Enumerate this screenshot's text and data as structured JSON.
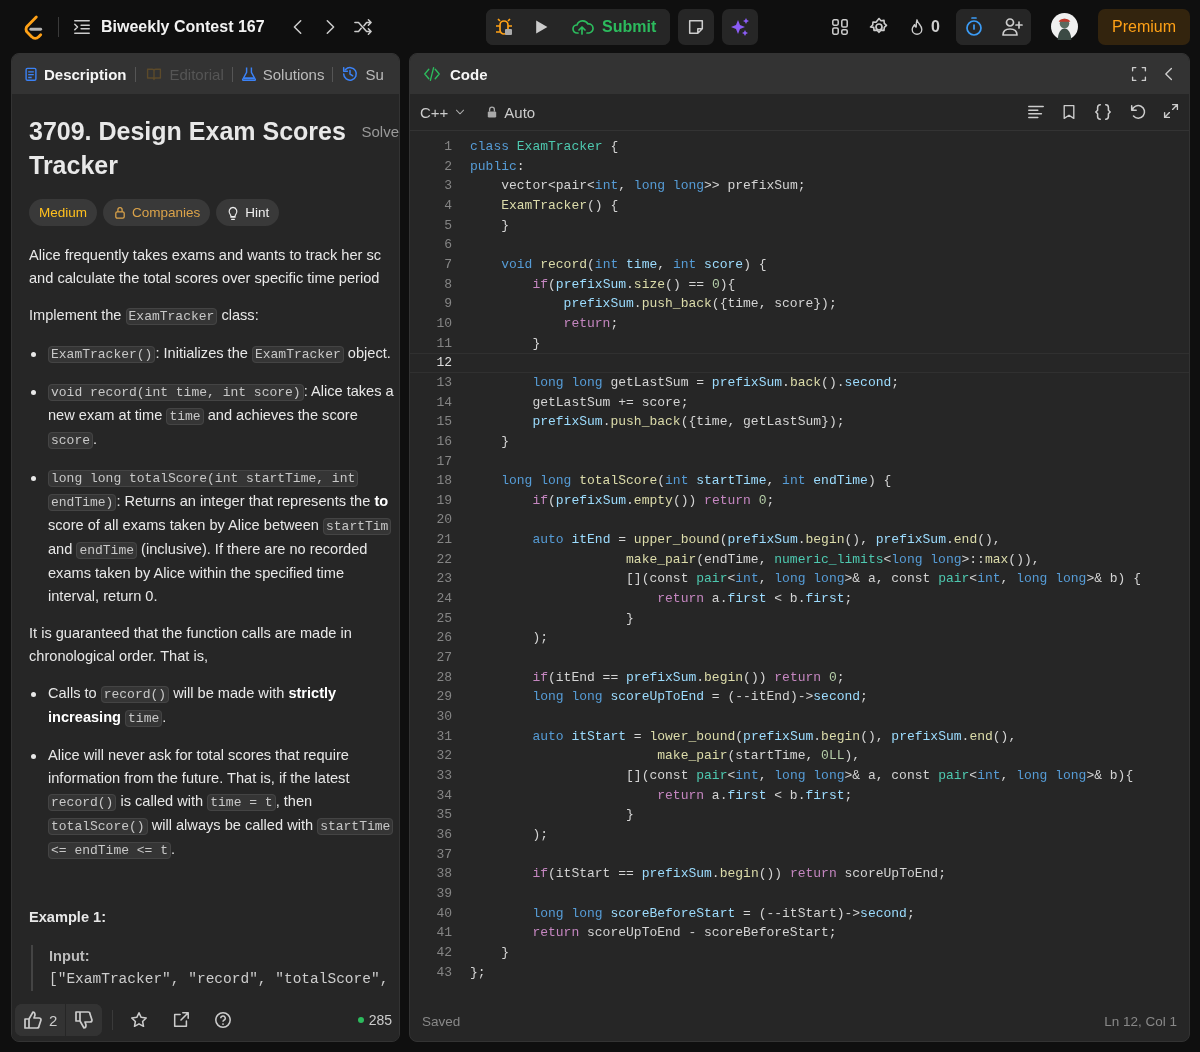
{
  "topbar": {
    "list_title": "Biweekly Contest 167",
    "submit": "Submit",
    "streak": "0",
    "premium": "Premium"
  },
  "description_panel": {
    "tabs": [
      {
        "kind": "doc",
        "label": "Description",
        "selected": true,
        "disabled": false
      },
      {
        "kind": "book",
        "label": "Editorial",
        "selected": false,
        "disabled": true
      },
      {
        "kind": "flask",
        "label": "Solutions",
        "selected": false,
        "disabled": false
      },
      {
        "kind": "history",
        "label": "Su",
        "selected": false,
        "disabled": false
      }
    ],
    "title": "3709. Design Exam Scores Tracker",
    "solved": "Solve",
    "tags": [
      {
        "kind": "difficulty",
        "label": "Medium"
      },
      {
        "kind": "locked",
        "label": "Companies"
      },
      {
        "kind": "hint",
        "label": "Hint"
      }
    ],
    "blocks": [
      {
        "kind": "para",
        "lines": [
          [
            {
              "kind": "text",
              "text": "Alice frequently takes exams and wants to track her sc"
            }
          ],
          [
            {
              "kind": "text",
              "text": "and calculate the total scores over specific time period"
            }
          ]
        ]
      },
      {
        "kind": "para",
        "lines": [
          [
            {
              "kind": "text",
              "text": "Implement the "
            },
            {
              "kind": "code",
              "text": "ExamTracker"
            },
            {
              "kind": "text",
              "text": " class:"
            }
          ]
        ]
      },
      {
        "kind": "bullet",
        "lines": [
          [
            {
              "kind": "code",
              "text": "ExamTracker()"
            },
            {
              "kind": "text",
              "text": ": Initializes the "
            },
            {
              "kind": "code",
              "text": "ExamTracker"
            },
            {
              "kind": "text",
              "text": " object."
            }
          ]
        ]
      },
      {
        "kind": "bullet",
        "lines": [
          [
            {
              "kind": "code",
              "text": "void record(int time, int score)"
            },
            {
              "kind": "text",
              "text": ": Alice takes a"
            }
          ],
          [
            {
              "kind": "text",
              "text": "new exam at time "
            },
            {
              "kind": "code",
              "text": "time"
            },
            {
              "kind": "text",
              "text": " and achieves the score"
            }
          ],
          [
            {
              "kind": "code",
              "text": "score"
            },
            {
              "kind": "text",
              "text": "."
            }
          ]
        ]
      },
      {
        "kind": "bullet",
        "lines": [
          [
            {
              "kind": "code",
              "text": "long long totalScore(int startTime, int"
            }
          ],
          [
            {
              "kind": "code",
              "text": "endTime)"
            },
            {
              "kind": "text",
              "text": ": Returns an integer that represents the "
            },
            {
              "kind": "bold",
              "text": "to"
            }
          ],
          [
            {
              "kind": "text",
              "text": "score of all exams taken by Alice between "
            },
            {
              "kind": "code",
              "text": "startTim"
            }
          ],
          [
            {
              "kind": "text",
              "text": "and "
            },
            {
              "kind": "code",
              "text": "endTime"
            },
            {
              "kind": "text",
              "text": " (inclusive). If there are no recorded"
            }
          ],
          [
            {
              "kind": "text",
              "text": "exams taken by Alice within the specified time"
            }
          ],
          [
            {
              "kind": "text",
              "text": "interval, return 0."
            }
          ]
        ]
      },
      {
        "kind": "para",
        "lines": [
          [
            {
              "kind": "text",
              "text": "It is guaranteed that the function calls are made in"
            }
          ],
          [
            {
              "kind": "text",
              "text": "chronological order. That is,"
            }
          ]
        ]
      },
      {
        "kind": "bullet",
        "lines": [
          [
            {
              "kind": "text",
              "text": "Calls to "
            },
            {
              "kind": "code",
              "text": "record()"
            },
            {
              "kind": "text",
              "text": " will be made with "
            },
            {
              "kind": "bold",
              "text": "strictly"
            }
          ],
          [
            {
              "kind": "bold",
              "text": "increasing "
            },
            {
              "kind": "code",
              "text": "time"
            },
            {
              "kind": "text",
              "text": "."
            }
          ]
        ]
      },
      {
        "kind": "bullet",
        "lines": [
          [
            {
              "kind": "text",
              "text": "Alice will never ask for total scores that require"
            }
          ],
          [
            {
              "kind": "text",
              "text": "information from the future. That is, if the latest"
            }
          ],
          [
            {
              "kind": "code",
              "text": "record()"
            },
            {
              "kind": "text",
              "text": " is called with "
            },
            {
              "kind": "code",
              "text": "time = t"
            },
            {
              "kind": "text",
              "text": ", then"
            }
          ],
          [
            {
              "kind": "code",
              "text": "totalScore()"
            },
            {
              "kind": "text",
              "text": " will always be called with "
            },
            {
              "kind": "code",
              "text": "startTime"
            }
          ],
          [
            {
              "kind": "code",
              "text": "<= endTime <= t"
            },
            {
              "kind": "text",
              "text": "."
            }
          ]
        ]
      },
      {
        "kind": "heading",
        "text": "Example 1:"
      },
      {
        "kind": "example",
        "label": "Input:",
        "code": "[\"ExamTracker\", \"record\", \"totalScore\","
      }
    ],
    "footer": {
      "likes": "2",
      "online": "285"
    }
  },
  "code_panel": {
    "title": "Code",
    "language": "C++",
    "mode": "Auto",
    "status": "Saved",
    "cursor": "Ln 12, Col 1",
    "lines": [
      {
        "n": "1",
        "active": false,
        "t": [
          {
            "kind": "keyword",
            "text": "class "
          },
          {
            "kind": "type",
            "text": "ExamTracker"
          },
          {
            "kind": "plain",
            "text": " {"
          }
        ]
      },
      {
        "n": "2",
        "active": false,
        "t": [
          {
            "kind": "keyword",
            "text": "public"
          },
          {
            "kind": "plain",
            "text": ":"
          }
        ]
      },
      {
        "n": "3",
        "active": false,
        "t": [
          {
            "kind": "plain",
            "text": "    vector<pair<"
          },
          {
            "kind": "keyword",
            "text": "int"
          },
          {
            "kind": "plain",
            "text": ", "
          },
          {
            "kind": "keyword",
            "text": "long long"
          },
          {
            "kind": "plain",
            "text": ">> prefixSum;"
          }
        ]
      },
      {
        "n": "4",
        "active": false,
        "t": [
          {
            "kind": "function",
            "text": "    ExamTracker"
          },
          {
            "kind": "plain",
            "text": "() {"
          }
        ]
      },
      {
        "n": "5",
        "active": false,
        "t": [
          {
            "kind": "plain",
            "text": "    }"
          }
        ]
      },
      {
        "n": "6",
        "active": false
      },
      {
        "n": "7",
        "active": false,
        "t": [
          {
            "kind": "keyword",
            "text": "    void "
          },
          {
            "kind": "function",
            "text": "record"
          },
          {
            "kind": "plain",
            "text": "("
          },
          {
            "kind": "keyword",
            "text": "int "
          },
          {
            "kind": "variable",
            "text": "time"
          },
          {
            "kind": "plain",
            "text": ", "
          },
          {
            "kind": "keyword",
            "text": "int "
          },
          {
            "kind": "variable",
            "text": "score"
          },
          {
            "kind": "plain",
            "text": ") {"
          }
        ]
      },
      {
        "n": "8",
        "active": false,
        "t": [
          {
            "kind": "control",
            "text": "        if"
          },
          {
            "kind": "plain",
            "text": "("
          },
          {
            "kind": "variable",
            "text": "prefixSum"
          },
          {
            "kind": "plain",
            "text": "."
          },
          {
            "kind": "function",
            "text": "size"
          },
          {
            "kind": "plain",
            "text": "() == "
          },
          {
            "kind": "number",
            "text": "0"
          },
          {
            "kind": "plain",
            "text": "){"
          }
        ]
      },
      {
        "n": "9",
        "active": false,
        "t": [
          {
            "kind": "variable",
            "text": "            prefixSum"
          },
          {
            "kind": "plain",
            "text": "."
          },
          {
            "kind": "function",
            "text": "push_back"
          },
          {
            "kind": "plain",
            "text": "({time, score});"
          }
        ]
      },
      {
        "n": "10",
        "active": false,
        "t": [
          {
            "kind": "control",
            "text": "            return"
          },
          {
            "kind": "plain",
            "text": ";"
          }
        ]
      },
      {
        "n": "11",
        "active": false,
        "t": [
          {
            "kind": "plain",
            "text": "        }"
          }
        ]
      },
      {
        "n": "12",
        "active": true
      },
      {
        "n": "13",
        "active": false,
        "t": [
          {
            "kind": "keyword",
            "text": "        long long"
          },
          {
            "kind": "plain",
            "text": " getLastSum = "
          },
          {
            "kind": "variable",
            "text": "prefixSum"
          },
          {
            "kind": "plain",
            "text": "."
          },
          {
            "kind": "function",
            "text": "back"
          },
          {
            "kind": "plain",
            "text": "()."
          },
          {
            "kind": "variable",
            "text": "second"
          },
          {
            "kind": "plain",
            "text": ";"
          }
        ]
      },
      {
        "n": "14",
        "active": false,
        "t": [
          {
            "kind": "plain",
            "text": "        getLastSum += score;"
          }
        ]
      },
      {
        "n": "15",
        "active": false,
        "t": [
          {
            "kind": "variable",
            "text": "        prefixSum"
          },
          {
            "kind": "plain",
            "text": "."
          },
          {
            "kind": "function",
            "text": "push_back"
          },
          {
            "kind": "plain",
            "text": "({time, getLastSum});"
          }
        ]
      },
      {
        "n": "16",
        "active": false,
        "t": [
          {
            "kind": "plain",
            "text": "    }"
          }
        ]
      },
      {
        "n": "17",
        "active": false
      },
      {
        "n": "18",
        "active": false,
        "t": [
          {
            "kind": "keyword",
            "text": "    long long "
          },
          {
            "kind": "function",
            "text": "totalScore"
          },
          {
            "kind": "plain",
            "text": "("
          },
          {
            "kind": "keyword",
            "text": "int "
          },
          {
            "kind": "variable",
            "text": "startTime"
          },
          {
            "kind": "plain",
            "text": ", "
          },
          {
            "kind": "keyword",
            "text": "int "
          },
          {
            "kind": "variable",
            "text": "endTime"
          },
          {
            "kind": "plain",
            "text": ") {"
          }
        ]
      },
      {
        "n": "19",
        "active": false,
        "t": [
          {
            "kind": "control",
            "text": "        if"
          },
          {
            "kind": "plain",
            "text": "("
          },
          {
            "kind": "variable",
            "text": "prefixSum"
          },
          {
            "kind": "plain",
            "text": "."
          },
          {
            "kind": "function",
            "text": "empty"
          },
          {
            "kind": "plain",
            "text": "()) "
          },
          {
            "kind": "control",
            "text": "return "
          },
          {
            "kind": "number",
            "text": "0"
          },
          {
            "kind": "plain",
            "text": ";"
          }
        ]
      },
      {
        "n": "20",
        "active": false
      },
      {
        "n": "21",
        "active": false,
        "t": [
          {
            "kind": "keyword",
            "text": "        auto "
          },
          {
            "kind": "variable",
            "text": "itEnd"
          },
          {
            "kind": "plain",
            "text": " = "
          },
          {
            "kind": "function",
            "text": "upper_bound"
          },
          {
            "kind": "plain",
            "text": "("
          },
          {
            "kind": "variable",
            "text": "prefixSum"
          },
          {
            "kind": "plain",
            "text": "."
          },
          {
            "kind": "function",
            "text": "begin"
          },
          {
            "kind": "plain",
            "text": "(), "
          },
          {
            "kind": "variable",
            "text": "prefixSum"
          },
          {
            "kind": "plain",
            "text": "."
          },
          {
            "kind": "function",
            "text": "end"
          },
          {
            "kind": "plain",
            "text": "(),"
          }
        ]
      },
      {
        "n": "22",
        "active": false,
        "t": [
          {
            "kind": "function",
            "text": "                    make_pair"
          },
          {
            "kind": "plain",
            "text": "(endTime, "
          },
          {
            "kind": "type",
            "text": "numeric_limits"
          },
          {
            "kind": "plain",
            "text": "<"
          },
          {
            "kind": "keyword",
            "text": "long long"
          },
          {
            "kind": "plain",
            "text": ">::"
          },
          {
            "kind": "function",
            "text": "max"
          },
          {
            "kind": "plain",
            "text": "()),"
          }
        ]
      },
      {
        "n": "23",
        "active": false,
        "t": [
          {
            "kind": "plain",
            "text": "                    [](const "
          },
          {
            "kind": "type",
            "text": "pair"
          },
          {
            "kind": "plain",
            "text": "<"
          },
          {
            "kind": "keyword",
            "text": "int"
          },
          {
            "kind": "plain",
            "text": ", "
          },
          {
            "kind": "keyword",
            "text": "long long"
          },
          {
            "kind": "plain",
            "text": ">& a, const "
          },
          {
            "kind": "type",
            "text": "pair"
          },
          {
            "kind": "plain",
            "text": "<"
          },
          {
            "kind": "keyword",
            "text": "int"
          },
          {
            "kind": "plain",
            "text": ", "
          },
          {
            "kind": "keyword",
            "text": "long long"
          },
          {
            "kind": "plain",
            "text": ">& b) {"
          }
        ]
      },
      {
        "n": "24",
        "active": false,
        "t": [
          {
            "kind": "control",
            "text": "                        return"
          },
          {
            "kind": "plain",
            "text": " a."
          },
          {
            "kind": "variable",
            "text": "first"
          },
          {
            "kind": "plain",
            "text": " < b."
          },
          {
            "kind": "variable",
            "text": "first"
          },
          {
            "kind": "plain",
            "text": ";"
          }
        ]
      },
      {
        "n": "25",
        "active": false,
        "t": [
          {
            "kind": "plain",
            "text": "                    }"
          }
        ]
      },
      {
        "n": "26",
        "active": false,
        "t": [
          {
            "kind": "plain",
            "text": "        );"
          }
        ]
      },
      {
        "n": "27",
        "active": false
      },
      {
        "n": "28",
        "active": false,
        "t": [
          {
            "kind": "control",
            "text": "        if"
          },
          {
            "kind": "plain",
            "text": "(itEnd == "
          },
          {
            "kind": "variable",
            "text": "prefixSum"
          },
          {
            "kind": "plain",
            "text": "."
          },
          {
            "kind": "function",
            "text": "begin"
          },
          {
            "kind": "plain",
            "text": "()) "
          },
          {
            "kind": "control",
            "text": "return "
          },
          {
            "kind": "number",
            "text": "0"
          },
          {
            "kind": "plain",
            "text": ";"
          }
        ]
      },
      {
        "n": "29",
        "active": false,
        "t": [
          {
            "kind": "keyword",
            "text": "        long long "
          },
          {
            "kind": "variable",
            "text": "scoreUpToEnd"
          },
          {
            "kind": "plain",
            "text": " = (--itEnd)->"
          },
          {
            "kind": "variable",
            "text": "second"
          },
          {
            "kind": "plain",
            "text": ";"
          }
        ]
      },
      {
        "n": "30",
        "active": false
      },
      {
        "n": "31",
        "active": false,
        "t": [
          {
            "kind": "keyword",
            "text": "        auto "
          },
          {
            "kind": "variable",
            "text": "itStart"
          },
          {
            "kind": "plain",
            "text": " = "
          },
          {
            "kind": "function",
            "text": "lower_bound"
          },
          {
            "kind": "plain",
            "text": "("
          },
          {
            "kind": "variable",
            "text": "prefixSum"
          },
          {
            "kind": "plain",
            "text": "."
          },
          {
            "kind": "function",
            "text": "begin"
          },
          {
            "kind": "plain",
            "text": "(), "
          },
          {
            "kind": "variable",
            "text": "prefixSum"
          },
          {
            "kind": "plain",
            "text": "."
          },
          {
            "kind": "function",
            "text": "end"
          },
          {
            "kind": "plain",
            "text": "(),"
          }
        ]
      },
      {
        "n": "32",
        "active": false,
        "t": [
          {
            "kind": "function",
            "text": "                        make_pair"
          },
          {
            "kind": "plain",
            "text": "(startTime, "
          },
          {
            "kind": "number",
            "text": "0LL"
          },
          {
            "kind": "plain",
            "text": "),"
          }
        ]
      },
      {
        "n": "33",
        "active": false,
        "t": [
          {
            "kind": "plain",
            "text": "                    [](const "
          },
          {
            "kind": "type",
            "text": "pair"
          },
          {
            "kind": "plain",
            "text": "<"
          },
          {
            "kind": "keyword",
            "text": "int"
          },
          {
            "kind": "plain",
            "text": ", "
          },
          {
            "kind": "keyword",
            "text": "long long"
          },
          {
            "kind": "plain",
            "text": ">& a, const "
          },
          {
            "kind": "type",
            "text": "pair"
          },
          {
            "kind": "plain",
            "text": "<"
          },
          {
            "kind": "keyword",
            "text": "int"
          },
          {
            "kind": "plain",
            "text": ", "
          },
          {
            "kind": "keyword",
            "text": "long long"
          },
          {
            "kind": "plain",
            "text": ">& b){"
          }
        ]
      },
      {
        "n": "34",
        "active": false,
        "t": [
          {
            "kind": "control",
            "text": "                        return"
          },
          {
            "kind": "plain",
            "text": " a."
          },
          {
            "kind": "variable",
            "text": "first"
          },
          {
            "kind": "plain",
            "text": " < b."
          },
          {
            "kind": "variable",
            "text": "first"
          },
          {
            "kind": "plain",
            "text": ";"
          }
        ]
      },
      {
        "n": "35",
        "active": false,
        "t": [
          {
            "kind": "plain",
            "text": "                    }"
          }
        ]
      },
      {
        "n": "36",
        "active": false,
        "t": [
          {
            "kind": "plain",
            "text": "        );"
          }
        ]
      },
      {
        "n": "37",
        "active": false
      },
      {
        "n": "38",
        "active": false,
        "t": [
          {
            "kind": "control",
            "text": "        if"
          },
          {
            "kind": "plain",
            "text": "(itStart == "
          },
          {
            "kind": "variable",
            "text": "prefixSum"
          },
          {
            "kind": "plain",
            "text": "."
          },
          {
            "kind": "function",
            "text": "begin"
          },
          {
            "kind": "plain",
            "text": "()) "
          },
          {
            "kind": "control",
            "text": "return"
          },
          {
            "kind": "plain",
            "text": " scoreUpToEnd;"
          }
        ]
      },
      {
        "n": "39",
        "active": false
      },
      {
        "n": "40",
        "active": false,
        "t": [
          {
            "kind": "keyword",
            "text": "        long long "
          },
          {
            "kind": "variable",
            "text": "scoreBeforeStart"
          },
          {
            "kind": "plain",
            "text": " = (--itStart)->"
          },
          {
            "kind": "variable",
            "text": "second"
          },
          {
            "kind": "plain",
            "text": ";"
          }
        ]
      },
      {
        "n": "41",
        "active": false,
        "t": [
          {
            "kind": "control",
            "text": "        return"
          },
          {
            "kind": "plain",
            "text": " scoreUpToEnd - scoreBeforeStart;"
          }
        ]
      },
      {
        "n": "42",
        "active": false,
        "t": [
          {
            "kind": "plain",
            "text": "    }"
          }
        ]
      },
      {
        "n": "43",
        "active": false,
        "t": [
          {
            "kind": "plain",
            "text": "};"
          }
        ]
      }
    ]
  }
}
